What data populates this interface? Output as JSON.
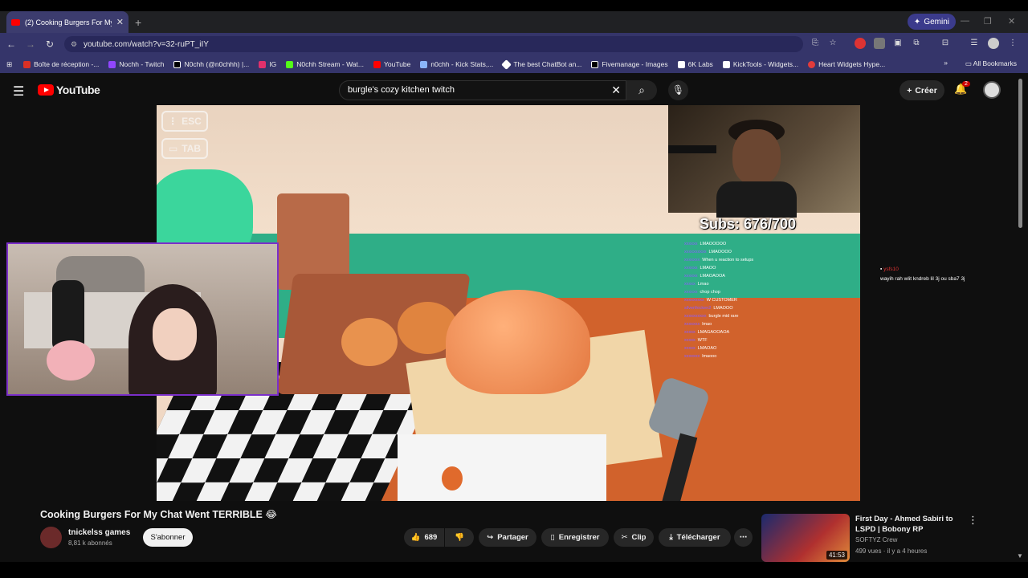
{
  "browser": {
    "tab_title": "(2) Cooking Burgers For My Ch",
    "new_tab": "+",
    "gemini_label": "Gemini",
    "url": "youtube.com/watch?v=32-ruPT_iIY",
    "all_bookmarks": "All Bookmarks",
    "bookmarks": [
      {
        "label": "Boîte de réception -...",
        "color": "#d93025"
      },
      {
        "label": "Nochh - Twitch",
        "color": "#9146ff"
      },
      {
        "label": "N0chh (@n0chhh) |...",
        "color": "#000000"
      },
      {
        "label": "IG",
        "color": "#e1306c"
      },
      {
        "label": "N0chh Stream - Wat...",
        "color": "#53fc18"
      },
      {
        "label": "YouTube",
        "color": "#ff0000"
      },
      {
        "label": "n0chh - Kick Stats,...",
        "color": "#8ab4f8"
      },
      {
        "label": "The best ChatBot an...",
        "color": "#ffffff"
      },
      {
        "label": "Fivemanage - Images",
        "color": "#000000"
      },
      {
        "label": "6K Labs",
        "color": "#ffffff"
      },
      {
        "label": "KickTools - Widgets...",
        "color": "#ffffff"
      },
      {
        "label": "Heart Widgets Hype...",
        "color": "#e23b3b"
      }
    ]
  },
  "youtube": {
    "logo_text": "YouTube",
    "search_value": "burgle's cozy kitchen twitch",
    "create_label": "Créer",
    "notif_count": "2"
  },
  "player": {
    "esc_label": "ESC",
    "tab_label": "TAB",
    "subs_counter": "Subs: 676/700",
    "chat_lines": [
      {
        "name": "xxxxxx",
        "msg": "LMAOOOOO"
      },
      {
        "name": "xxxxxxxxxx",
        "msg": "LMAOOOO"
      },
      {
        "name": "xxxxxxx",
        "msg": "When u reaction to setups"
      },
      {
        "name": "xxxxxx",
        "msg": "LMAOO"
      },
      {
        "name": "xxxxxx",
        "msg": "LMAOAOOA"
      },
      {
        "name": "xxxxx",
        "msg": "Lmao"
      },
      {
        "name": "xxxxxx",
        "msg": "chop chop"
      },
      {
        "name": "xxxxxxxxx",
        "msg": "W CUSTOMER"
      },
      {
        "name": "silverthicken2",
        "msg": "LMAOOO"
      },
      {
        "name": "xxxxxxxxxx",
        "msg": "burgle mid rare"
      },
      {
        "name": "xxxxxxx",
        "msg": "lmao"
      },
      {
        "name": "xxxxx",
        "msg": "LMAGAOOAOA"
      },
      {
        "name": "xxxxx",
        "msg": "WTF"
      },
      {
        "name": "xxxxx",
        "msg": "LMAOAO"
      },
      {
        "name": "xxxxxxx",
        "msg": "lmaooo"
      }
    ],
    "side_chat_name": "ysfs10",
    "side_chat_msg": "wayih rah wlit kndreb lil 3j ou sba7 3j"
  },
  "video": {
    "title": "Cooking Burgers For My Chat Went TERRIBLE 😂",
    "channel": "tnickelss games",
    "subscribers": "8,81 k abonnés",
    "subscribe_label": "S'abonner",
    "likes": "689",
    "share_label": "Partager",
    "save_label": "Enregistrer",
    "clip_label": "Clip",
    "download_label": "Télécharger"
  },
  "recommendation": {
    "title": "First Day - Ahmed Sabiri to LSPD | Bobony RP",
    "channel": "SOFTYZ Crew",
    "meta": "499 vues · il y a 4 heures",
    "duration": "41:53"
  }
}
